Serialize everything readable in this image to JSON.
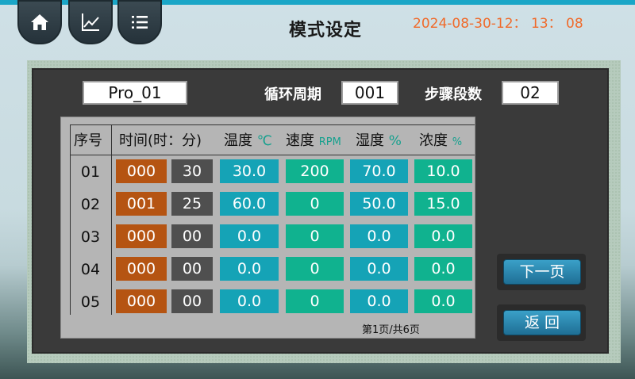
{
  "header": {
    "title": "模式设定",
    "datetime": "2024-08-30-12： 13： 08"
  },
  "nav": {
    "home_icon": "home-icon",
    "chart_icon": "line-chart-icon",
    "list_icon": "list-icon"
  },
  "program": {
    "name": "Pro_01",
    "cycle_label": "循环周期",
    "cycle_value": "001",
    "steps_label": "步骤段数",
    "steps_value": "02"
  },
  "table": {
    "headers": {
      "seq": "序号",
      "time": "时间(时：分)",
      "temp": "温度",
      "temp_unit": "℃",
      "speed": "速度",
      "speed_unit": "RPM",
      "humidity": "湿度",
      "humidity_unit": "%",
      "concentration": "浓度",
      "concentration_unit": "%"
    },
    "rows": [
      {
        "seq": "01",
        "hour": "000",
        "min": "30",
        "temp": "30.0",
        "speed": "200",
        "humidity": "70.0",
        "conc": "10.0"
      },
      {
        "seq": "02",
        "hour": "001",
        "min": "25",
        "temp": "60.0",
        "speed": "0",
        "humidity": "50.0",
        "conc": "15.0"
      },
      {
        "seq": "03",
        "hour": "000",
        "min": "00",
        "temp": "0.0",
        "speed": "0",
        "humidity": "0.0",
        "conc": "0.0"
      },
      {
        "seq": "04",
        "hour": "000",
        "min": "00",
        "temp": "0.0",
        "speed": "0",
        "humidity": "0.0",
        "conc": "0.0"
      },
      {
        "seq": "05",
        "hour": "000",
        "min": "00",
        "temp": "0.0",
        "speed": "0",
        "humidity": "0.0",
        "conc": "0.0"
      }
    ],
    "page_info": "第1页/共6页"
  },
  "buttons": {
    "next": "下一页",
    "back": "返 回"
  },
  "colors": {
    "accent": "#1aa6c7",
    "datetime": "#f06a2a",
    "hour_cell": "#b55412",
    "min_cell": "#4f4f4f",
    "teal_cell": "#15a3b6",
    "green_cell": "#10b28f"
  }
}
